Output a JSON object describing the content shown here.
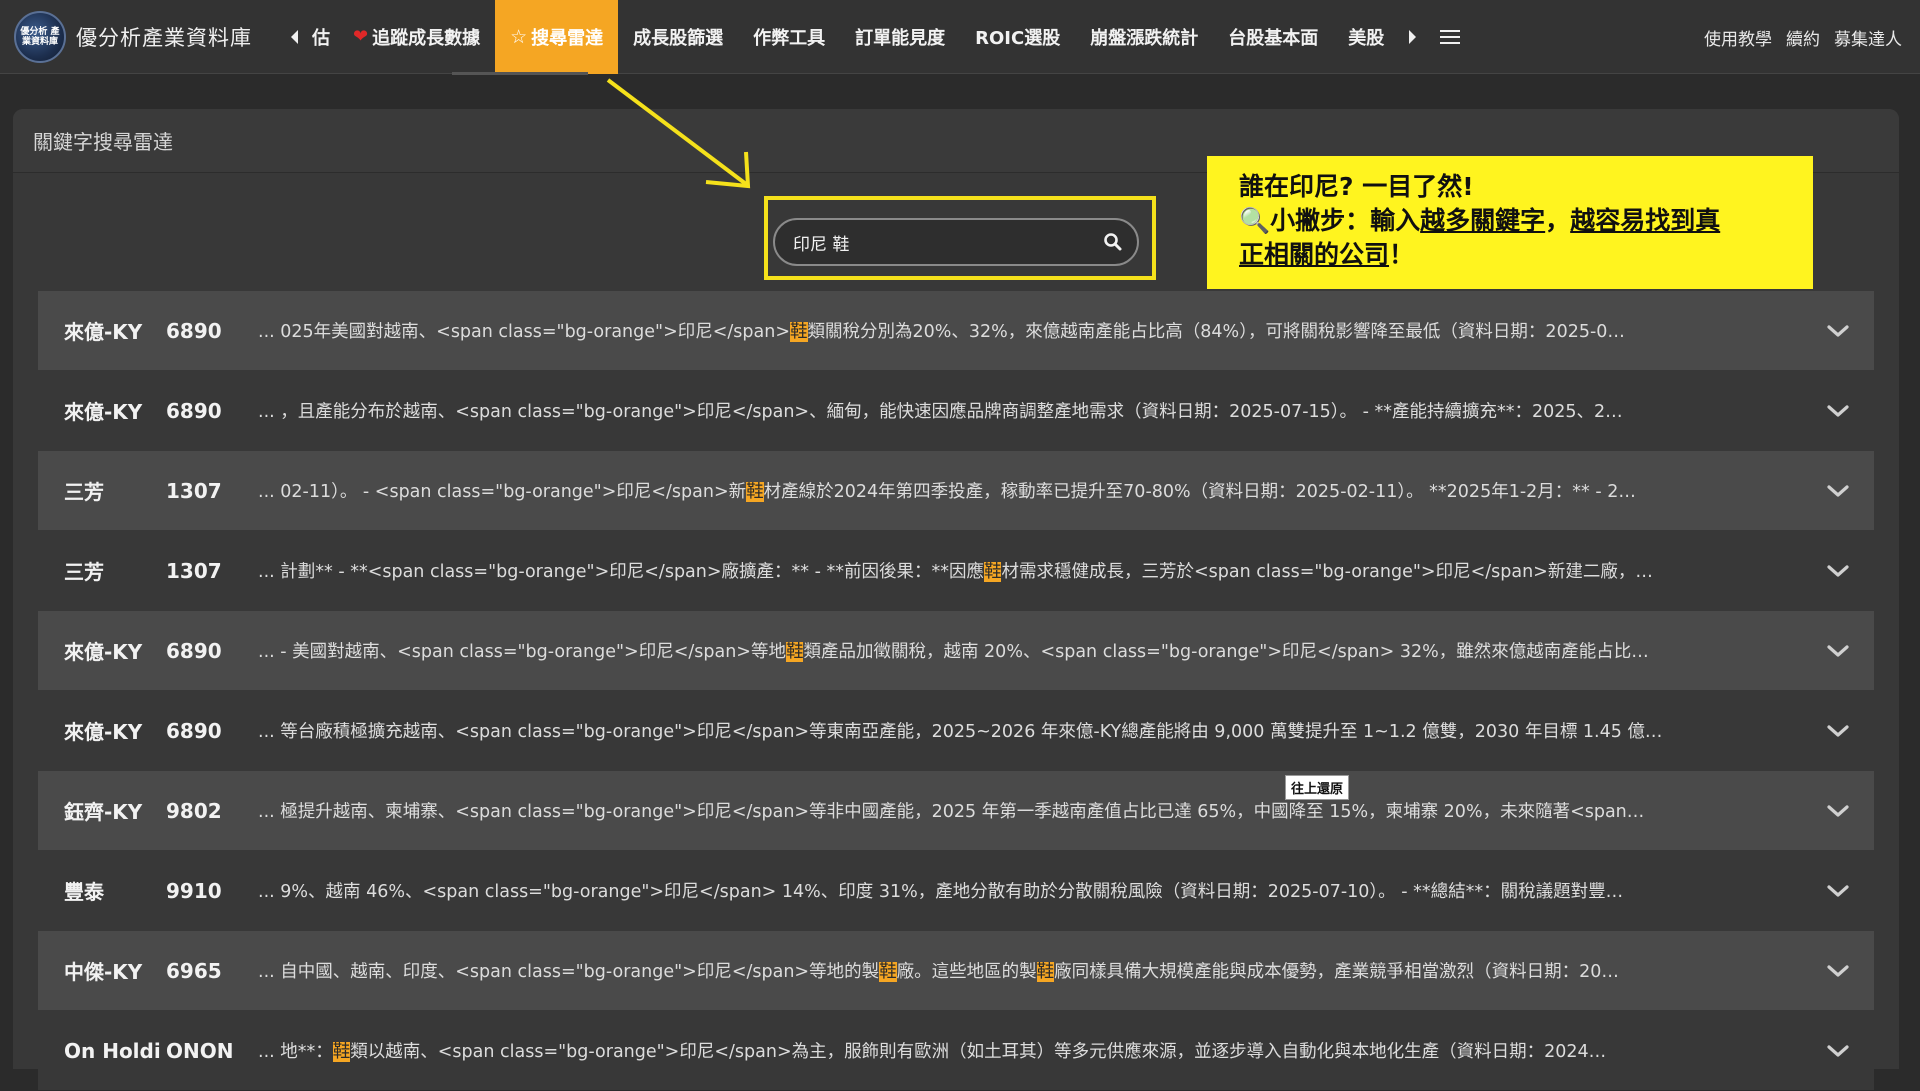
{
  "brand": {
    "logo_text": "優分析 產業資料庫",
    "name": "優分析產業資料庫"
  },
  "nav": {
    "prev_icon": "caret-left-icon",
    "next_icon": "caret-right-icon",
    "menu_icon": "hamburger-icon",
    "items": [
      {
        "label": "估"
      },
      {
        "label": "追蹤成長數據"
      },
      {
        "label": "搜尋雷達"
      },
      {
        "label": "成長股篩選"
      },
      {
        "label": "作弊工具"
      },
      {
        "label": "訂單能見度"
      },
      {
        "label": "ROIC選股"
      },
      {
        "label": "崩盤漲跌統計"
      },
      {
        "label": "台股基本面"
      },
      {
        "label": "美股"
      }
    ],
    "right": [
      {
        "label": "使用教學"
      },
      {
        "label": "續約"
      },
      {
        "label": "募集達人"
      }
    ]
  },
  "panel": {
    "title": "關鍵字搜尋雷達"
  },
  "search": {
    "value": "印尼 鞋",
    "icon": "search-icon"
  },
  "callout": {
    "line1": "誰在印尼? 一目了然!",
    "line2_icon": "🔍",
    "line2_a": "小撇步：輸入",
    "line2_b": "越多關鍵字",
    "line2_c": "，",
    "line2_d": "越容易找到真",
    "line3_a": "正相關的公司",
    "line3_b": "！"
  },
  "tooltip": "往上還原",
  "results": [
    {
      "name": "來億-KY",
      "code": "6890",
      "pre": "... 025年美國對越南、<span class=\"bg-orange\">印尼</span>",
      "hl": "鞋",
      "post": "類關稅分別為20%、32%，來億越南產能占比高（84%），可將關稅影響降至最低（資料日期：2025-0…"
    },
    {
      "name": "來億-KY",
      "code": "6890",
      "pre": "... ，且產能分布於越南、<span class=\"bg-orange\">印尼</span>、緬甸，能快速因應品牌商調整產地需求（資料日期：2025-07-15）。 - **產能持續擴充**：2025、2…",
      "hl": "",
      "post": ""
    },
    {
      "name": "三芳",
      "code": "1307",
      "pre": "... 02-11）。 - <span class=\"bg-orange\">印尼</span>新",
      "hl": "鞋",
      "post": "材產線於2024年第四季投產，稼動率已提升至70-80%（資料日期：2025-02-11）。 **2025年1-2月：** - 2…"
    },
    {
      "name": "三芳",
      "code": "1307",
      "pre": "... 計劃** - **<span class=\"bg-orange\">印尼</span>廠擴產：** - **前因後果：**因應",
      "hl": "鞋",
      "post": "材需求穩健成長，三芳於<span class=\"bg-orange\">印尼</span>新建二廠，…"
    },
    {
      "name": "來億-KY",
      "code": "6890",
      "pre": "... - 美國對越南、<span class=\"bg-orange\">印尼</span>等地",
      "hl": "鞋",
      "post": "類產品加徵關稅，越南 20%、<span class=\"bg-orange\">印尼</span> 32%，雖然來億越南產能占比…"
    },
    {
      "name": "來億-KY",
      "code": "6890",
      "pre": "... 等台廠積極擴充越南、<span class=\"bg-orange\">印尼</span>等東南亞產能，2025~2026 年來億-KY總產能將由 9,000 萬雙提升至 1~1.2 億雙，2030 年目標 1.45 億…",
      "hl": "",
      "post": ""
    },
    {
      "name": "鈺齊-KY",
      "code": "9802",
      "pre": "... 極提升越南、柬埔寨、<span class=\"bg-orange\">印尼</span>等非中國產能，2025 年第一季越南產值占比已達 65%，中國降至 15%，柬埔寨 20%，未來隨著<span…",
      "hl": "",
      "post": ""
    },
    {
      "name": "豐泰",
      "code": "9910",
      "pre": "... 9%、越南 46%、<span class=\"bg-orange\">印尼</span> 14%、印度 31%，產地分散有助於分散關稅風險（資料日期：2025-07-10）。 - **總結**：關稅議題對豐…",
      "hl": "",
      "post": ""
    },
    {
      "name": "中傑-KY",
      "code": "6965",
      "pre": "... 自中國、越南、印度、<span class=\"bg-orange\">印尼</span>等地的製",
      "hl": "鞋",
      "post": "廠。這些地區的製",
      "hl2": "鞋",
      "post2": "廠同樣具備大規模產能與成本優勢，產業競爭相當激烈（資料日期：20…"
    },
    {
      "name": "On Holdi",
      "code": "ONON",
      "pre": "... 地**：",
      "hl": "鞋",
      "post": "類以越南、<span class=\"bg-orange\">印尼</span>為主，服飾則有歐洲（如土耳其）等多元供應來源，並逐步導入自動化與本地化生產（資料日期：2024…"
    }
  ],
  "colors": {
    "accent": "#f5a623",
    "callout": "#fff41f",
    "highlight_border": "#f5e11b"
  }
}
